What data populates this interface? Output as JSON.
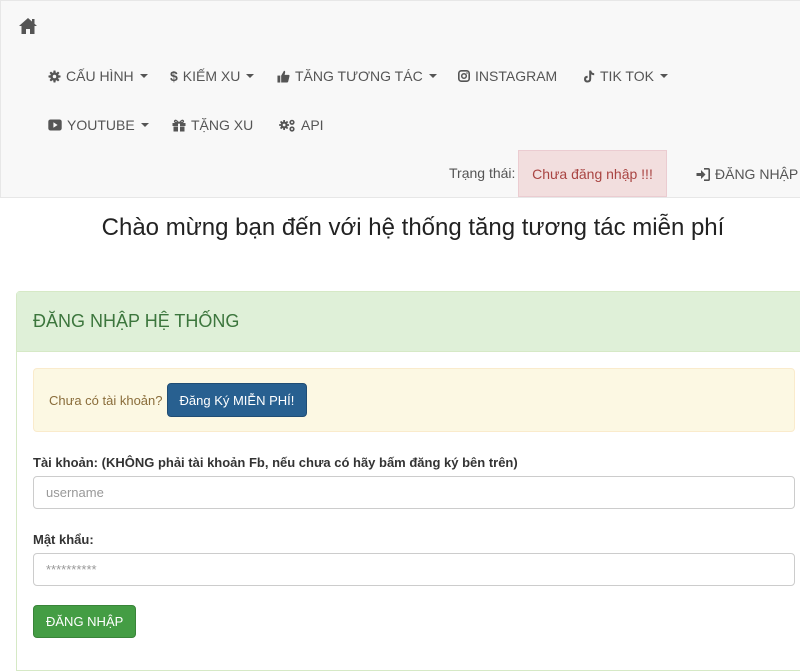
{
  "nav": {
    "home_icon": "home-icon",
    "items": [
      {
        "label": "CẤU HÌNH",
        "icon": "gear-icon",
        "dropdown": true
      },
      {
        "label": "KIẾM XU",
        "icon": "dollar-icon",
        "dropdown": true
      },
      {
        "label": "TĂNG TƯƠNG TÁC",
        "icon": "thumbs-up-icon",
        "dropdown": true
      },
      {
        "label": "INSTAGRAM",
        "icon": "instagram-icon",
        "dropdown": false
      },
      {
        "label": "TIK TOK",
        "icon": "tiktok-icon",
        "dropdown": true
      },
      {
        "label": "YOUTUBE",
        "icon": "youtube-icon",
        "dropdown": true
      },
      {
        "label": "TẶNG XU",
        "icon": "gift-icon",
        "dropdown": false
      },
      {
        "label": "API",
        "icon": "gears-icon",
        "dropdown": false
      }
    ],
    "status_label": "Trạng thái:",
    "status_value": "Chưa đăng nhập !!!",
    "login_link": "ĐĂNG NHẬP",
    "login_icon": "sign-in-icon"
  },
  "welcome": "Chào mừng bạn đến với hệ thống tăng tương tác miễn phí",
  "panel": {
    "heading": "ĐĂNG NHẬP HỆ THỐNG",
    "alert_text": "Chưa có tài khoản?",
    "register_button": "Đăng Ký MIỄN PHÍ!",
    "username_label": "Tài khoản: (KHÔNG phải tài khoản Fb, nếu chưa có hãy bấm đăng ký bên trên)",
    "username_placeholder": "username",
    "username_value": "",
    "password_label": "Mật khẩu:",
    "password_placeholder": "**********",
    "password_value": "",
    "submit_button": "ĐĂNG NHẬP"
  },
  "colors": {
    "navbar_bg": "#f8f8f8",
    "status_badge_bg": "#f2dede",
    "status_badge_text": "#a94442",
    "panel_heading_bg": "#dff0d8",
    "panel_heading_text": "#3c763d",
    "alert_bg": "#fcf8e3",
    "register_button_bg": "#286090",
    "login_button_bg": "#449d44"
  }
}
